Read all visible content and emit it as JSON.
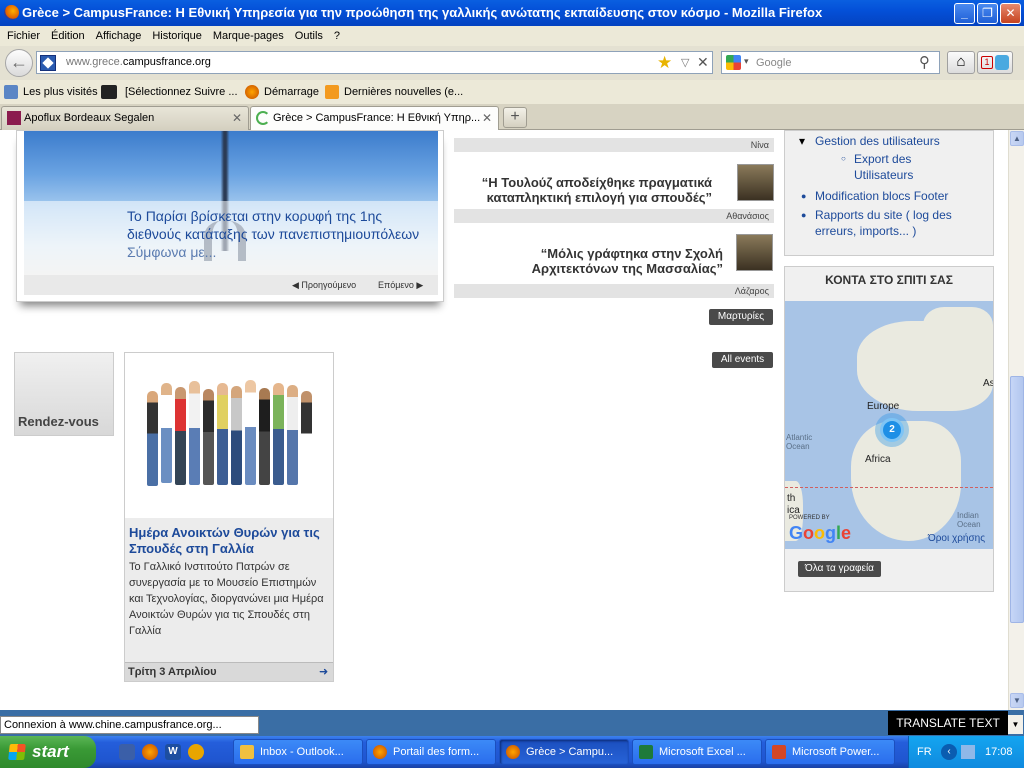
{
  "window": {
    "title": "Grèce > CampusFrance: Η Εθνική Υπηρεσία για την προώθηση της γαλλικής ανώτατης εκπαίδευσης στον κόσμο - Mozilla Firefox"
  },
  "menu": [
    "Fichier",
    "Édition",
    "Affichage",
    "Historique",
    "Marque-pages",
    "Outils",
    "?"
  ],
  "urlbar": {
    "prefix": "www.grece.",
    "domain": "campusfrance.org"
  },
  "search": {
    "placeholder": "Google"
  },
  "bookmarks": [
    "Les plus visités",
    "[Sélectionnez Suivre ...",
    "Démarrage",
    "Dernières nouvelles (e..."
  ],
  "tabs": [
    "Apoflux Bordeaux Segalen",
    "Grèce > CampusFrance: Η Εθνική Υπηρ..."
  ],
  "slider": {
    "text": "Το Παρίσι βρίσκεται στην κορυφή της 1ης διεθνούς κατάταξης των πανεπιστημιουπόλεων",
    "more": "Σύμφωνα με...",
    "prev": "Προηγούμενο",
    "next": "Επόμενο"
  },
  "testimonials": [
    {
      "text": "",
      "author": "Νίνα"
    },
    {
      "text": "“Η Τουλούζ αποδείχθηκε πραγματικά καταπληκτική επιλογή για σπουδές”",
      "author": "Αθανάσιος"
    },
    {
      "text": "“Μόλις γράφτηκα στην Σχολή Αρχιτεκτόνων της Μασσαλίας”",
      "author": "Λάζαρος"
    }
  ],
  "buttons": {
    "testimonials": "Μαρτυρίες",
    "events": "All events",
    "offices": "Όλα τα γραφεία"
  },
  "rendezvous": {
    "label": "Rendez-vous"
  },
  "event": {
    "title": "Ημέρα Ανοικτών Θυρών για τις Σπουδές στη Γαλλία",
    "desc": "Το Γαλλικό Ινστιτούτο Πατρών σε συνεργασία με το Μουσείο Επιστημών και Τεχνολογίας, διοργανώνει μια Ημέρα Ανοικτών Θυρών για τις Σπουδές στη Γαλλία",
    "date": "Τρίτη 3 Απριλίου"
  },
  "admin": {
    "gestion": "Gestion des utilisateurs",
    "export": "Export des Utilisateurs",
    "footer": "Modification blocs Footer",
    "rapports": "Rapports du site ( log des erreurs, imports... )"
  },
  "map": {
    "title": "ΚΟΝΤΑ ΣΤΟ ΣΠΙΤΙ ΣΑΣ",
    "europe": "Europe",
    "africa": "Africa",
    "asia": "As",
    "atlantic": "Atlantic Ocean",
    "indian": "Indian Ocean",
    "marker": "2",
    "powered": "POWERED BY",
    "google": "Google",
    "terms": "Όροι χρήσης",
    "south": "th",
    "south2": "ica"
  },
  "status": {
    "text": "Connexion à www.chine.campusfrance.org...",
    "translate": "TRANSLATE TEXT"
  },
  "taskbar": {
    "start": "start",
    "tasks": [
      "Inbox - Outlook...",
      "Portail des form...",
      "Grèce > Campu...",
      "Microsoft Excel ...",
      "Microsoft Power..."
    ],
    "lang": "FR",
    "clock": "17:08"
  },
  "colors": {
    "link": "#1d4a9a",
    "taskbar": "#245edb",
    "titlebar": "#0450d8"
  }
}
